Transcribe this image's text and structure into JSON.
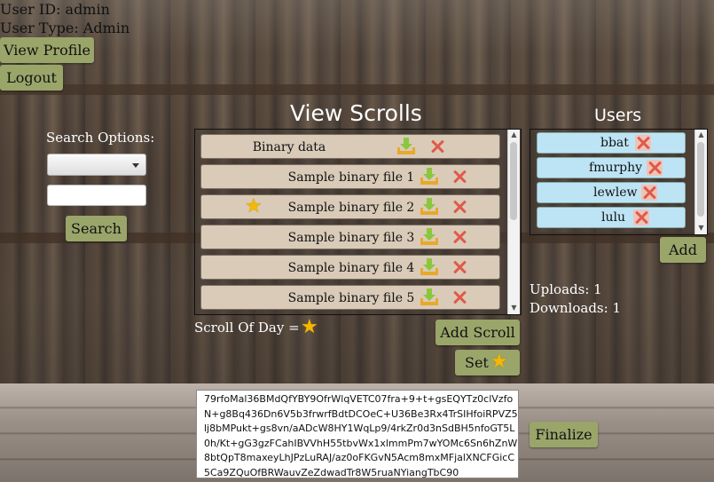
{
  "user": {
    "id_text": "User ID: admin",
    "type_text": "User Type: Admin",
    "view_profile_label": "View Profile",
    "logout_label": "Logout"
  },
  "search": {
    "heading": "Search Options:",
    "select_value": "",
    "input_value": "",
    "button_label": "Search"
  },
  "scrolls": {
    "title": "View Scrolls",
    "items": [
      {
        "label": "Binary data",
        "starred": false
      },
      {
        "label": "Sample binary file 1",
        "starred": false
      },
      {
        "label": "Sample binary file 2",
        "starred": true
      },
      {
        "label": "Sample binary file 3",
        "starred": false
      },
      {
        "label": "Sample binary file 4",
        "starred": false
      },
      {
        "label": "Sample binary file 5",
        "starred": false
      }
    ],
    "scroll_of_day_label": "Scroll Of Day =",
    "add_scroll_label": "Add Scroll",
    "set_label": "Set"
  },
  "users": {
    "title": "Users",
    "items": [
      "bbat",
      "fmurphy",
      "lewlew",
      "lulu"
    ],
    "add_label": "Add"
  },
  "stats": {
    "uploads_text": "Uploads: 1",
    "downloads_text": "Downloads: 1"
  },
  "editor": {
    "content": "79rfoMal36BMdQfYBY9OfrWlqVETC07fra+9+t+gsEQYTz0clVzfoN+g8Bq436Dn6V5b3frwrfBdtDCOeC+U36Be3Rx4TrSIHfoiRPVZ5lj8bMPukt+gs8vn/aADcW8HY1WqLp9/4rkZr0d3nSdBH5nfoGT5L0h/Kt+gG3gzFCahIBVVhH55tbvWx1xlmmPm7wYOMc6Sn6hZnW8btQpT8maxeyLhJPzLuRAJ/az0oFKGvN5Acm8mxMFjalXNCFGicC5Ca9ZQuOfBRWauvZeZdwadTr8W5ruaNYiangTbC90",
    "finalize_label": "Finalize"
  },
  "colors": {
    "button_bg": "#9aa56a",
    "scroll_item_bg": "#d9cbb8",
    "user_item_bg": "#bde4f4",
    "delete_red": "#e05a4a",
    "star_gold": "#f5b800",
    "download_green": "#8cc63e"
  },
  "icons": {
    "download": "download-icon",
    "delete": "delete-icon",
    "star": "star-icon"
  }
}
